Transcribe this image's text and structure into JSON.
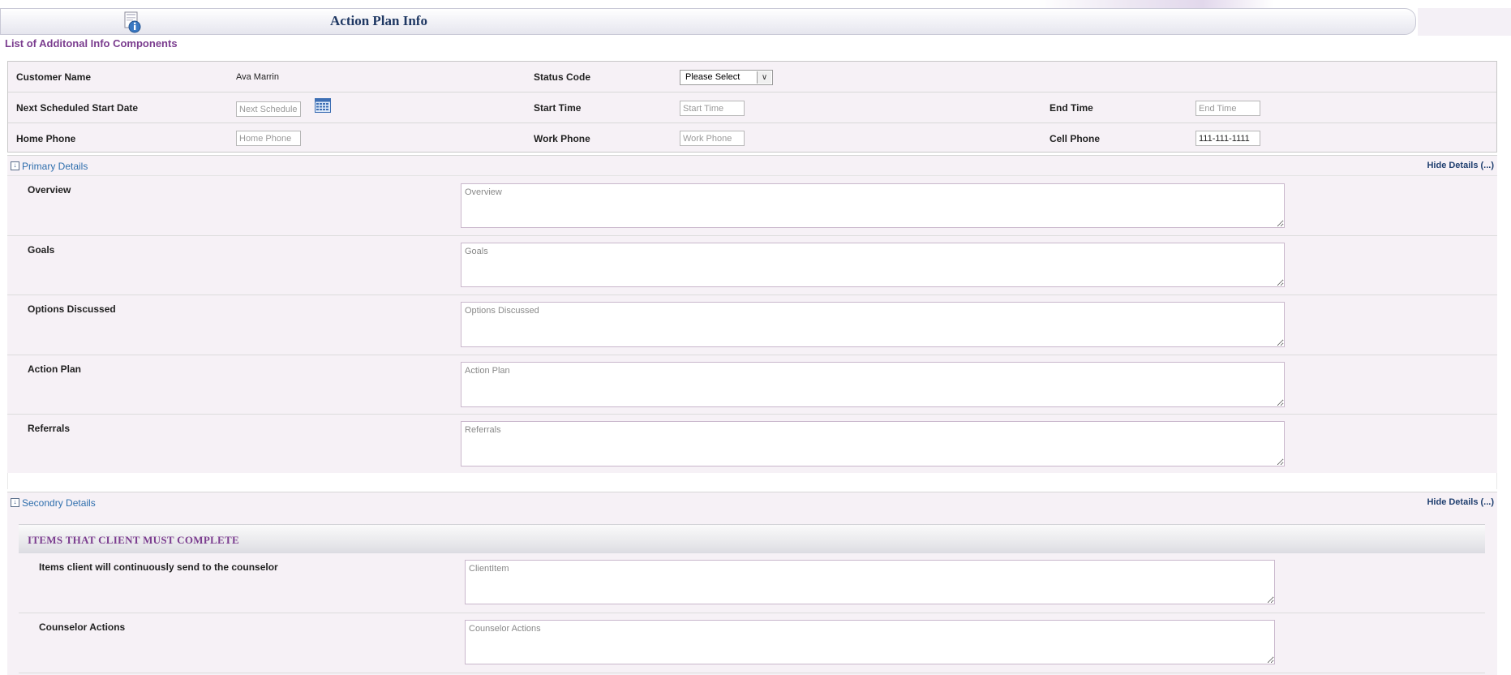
{
  "header": {
    "title": "Action Plan Info",
    "subtitle": "List of Additonal Info Components"
  },
  "info": {
    "customer_name_label": "Customer Name",
    "customer_name_value": "Ava Marrin",
    "status_code_label": "Status Code",
    "status_code_value": "Please Select",
    "next_start_label": "Next Scheduled Start Date",
    "next_start_placeholder": "Next Scheduled",
    "start_time_label": "Start Time",
    "start_time_placeholder": "Start Time",
    "end_time_label": "End Time",
    "end_time_placeholder": "End Time",
    "home_phone_label": "Home Phone",
    "home_phone_placeholder": "Home Phone",
    "work_phone_label": "Work Phone",
    "work_phone_placeholder": "Work Phone",
    "cell_phone_label": "Cell Phone",
    "cell_phone_value": "111-111-1111"
  },
  "primary": {
    "title": "Primary Details",
    "hide_label": "Hide Details (...)",
    "fields": [
      {
        "label": "Overview",
        "placeholder": "Overview"
      },
      {
        "label": "Goals",
        "placeholder": "Goals"
      },
      {
        "label": "Options Discussed",
        "placeholder": "Options Discussed"
      },
      {
        "label": "Action Plan",
        "placeholder": "Action Plan"
      },
      {
        "label": "Referrals",
        "placeholder": "Referrals"
      }
    ]
  },
  "secondary": {
    "title": "Secondry Details",
    "hide_label": "Hide Details (...)",
    "items_heading": "ITEMS THAT CLIENT MUST COMPLETE",
    "fields": [
      {
        "label": "Items client will continuously send to the counselor",
        "placeholder": "ClientItem"
      },
      {
        "label": "Counselor Actions",
        "placeholder": "Counselor Actions"
      }
    ]
  },
  "icons": {
    "title_icon": "info-document-icon",
    "calendar": "calendar-icon",
    "toggle": "collapse-chevron-icon",
    "resize": "resize-grip-icon"
  },
  "colors": {
    "title_text": "#1f3863",
    "subtitle_text": "#7b3d8f",
    "section_link": "#2f6fad",
    "panel_bg": "#f6f1f6"
  }
}
